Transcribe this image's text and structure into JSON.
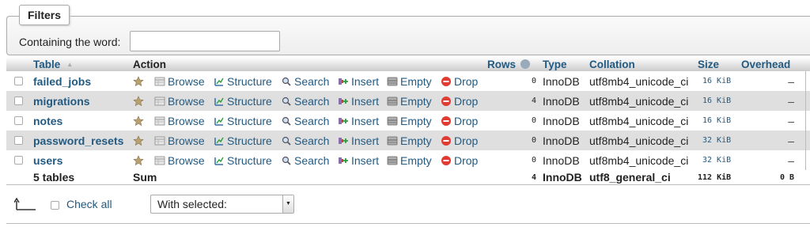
{
  "filters": {
    "legend": "Filters",
    "label": "Containing the word:",
    "value": ""
  },
  "columns": {
    "table": "Table",
    "sort_indicator": "▲",
    "action": "Action",
    "rows": "Rows",
    "type": "Type",
    "collation": "Collation",
    "size": "Size",
    "overhead": "Overhead"
  },
  "actions": {
    "browse": "Browse",
    "structure": "Structure",
    "search": "Search",
    "insert": "Insert",
    "empty": "Empty",
    "drop": "Drop"
  },
  "tables": [
    {
      "name": "failed_jobs",
      "rows": "0",
      "type": "InnoDB",
      "collation": "utf8mb4_unicode_ci",
      "size": "16 KiB",
      "overhead": "–"
    },
    {
      "name": "migrations",
      "rows": "4",
      "type": "InnoDB",
      "collation": "utf8mb4_unicode_ci",
      "size": "16 KiB",
      "overhead": "–"
    },
    {
      "name": "notes",
      "rows": "0",
      "type": "InnoDB",
      "collation": "utf8mb4_unicode_ci",
      "size": "16 KiB",
      "overhead": "–"
    },
    {
      "name": "password_resets",
      "rows": "0",
      "type": "InnoDB",
      "collation": "utf8mb4_unicode_ci",
      "size": "32 KiB",
      "overhead": "–"
    },
    {
      "name": "users",
      "rows": "0",
      "type": "InnoDB",
      "collation": "utf8mb4_unicode_ci",
      "size": "32 KiB",
      "overhead": "–"
    }
  ],
  "footer": {
    "count": "5 tables",
    "sum": "Sum",
    "rows": "4",
    "type": "InnoDB",
    "collation": "utf8_general_ci",
    "size": "112 KiB",
    "overhead": "0 B"
  },
  "bulk": {
    "check_all": "Check all",
    "with_selected": "With selected:"
  },
  "colors": {
    "link": "#235a81",
    "row_alt": "#dfdfdf",
    "drop": "#e03c31"
  }
}
